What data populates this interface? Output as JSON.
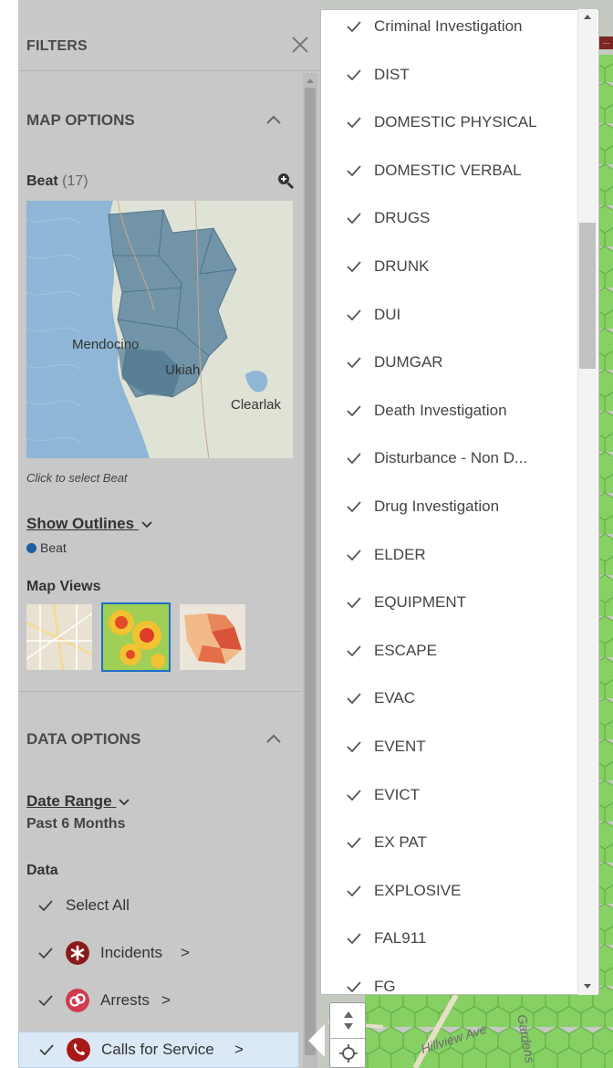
{
  "filters": {
    "title": "FILTERS",
    "map_options": {
      "title": "MAP OPTIONS",
      "beat_label": "Beat",
      "beat_count": "(17)",
      "map_labels": [
        "Mendocino",
        "Ukiah",
        "Clearlak"
      ],
      "caption": "Click to select Beat",
      "show_outlines": "Show Outlines",
      "legend_beat": "Beat",
      "map_views_label": "Map Views"
    },
    "data_options": {
      "title": "DATA OPTIONS",
      "date_range_label": "Date Range",
      "date_range_value": "Past 6 Months",
      "data_label": "Data",
      "select_all": "Select All",
      "rows": [
        {
          "label": "Incidents",
          "suffix": ">",
          "icon": "asterisk-icon",
          "color": "#8b1a1a"
        },
        {
          "label": "Arrests",
          "suffix": ">",
          "icon": "handcuffs-icon",
          "color": "#d23a4e"
        },
        {
          "label": "Calls for Service",
          "suffix": ">",
          "icon": "phone-icon",
          "color": "#a81818"
        }
      ]
    }
  },
  "dropdown": {
    "items": [
      "Criminal Investigation",
      "DIST",
      "DOMESTIC PHYSICAL",
      "DOMESTIC VERBAL",
      "DRUGS",
      "DRUNK",
      "DUI",
      "DUMGAR",
      "Death Investigation",
      "Disturbance - Non D...",
      "Drug Investigation",
      "ELDER",
      "EQUIPMENT",
      "ESCAPE",
      "EVAC",
      "EVENT",
      "EVICT",
      "EX PAT",
      "EXPLOSIVE",
      "FAL911",
      "FG"
    ]
  },
  "map": {
    "street_1": "Hillview Ave",
    "street_2": "Gardens",
    "hex_color": "#7ccf5a",
    "top_mark": "..."
  }
}
